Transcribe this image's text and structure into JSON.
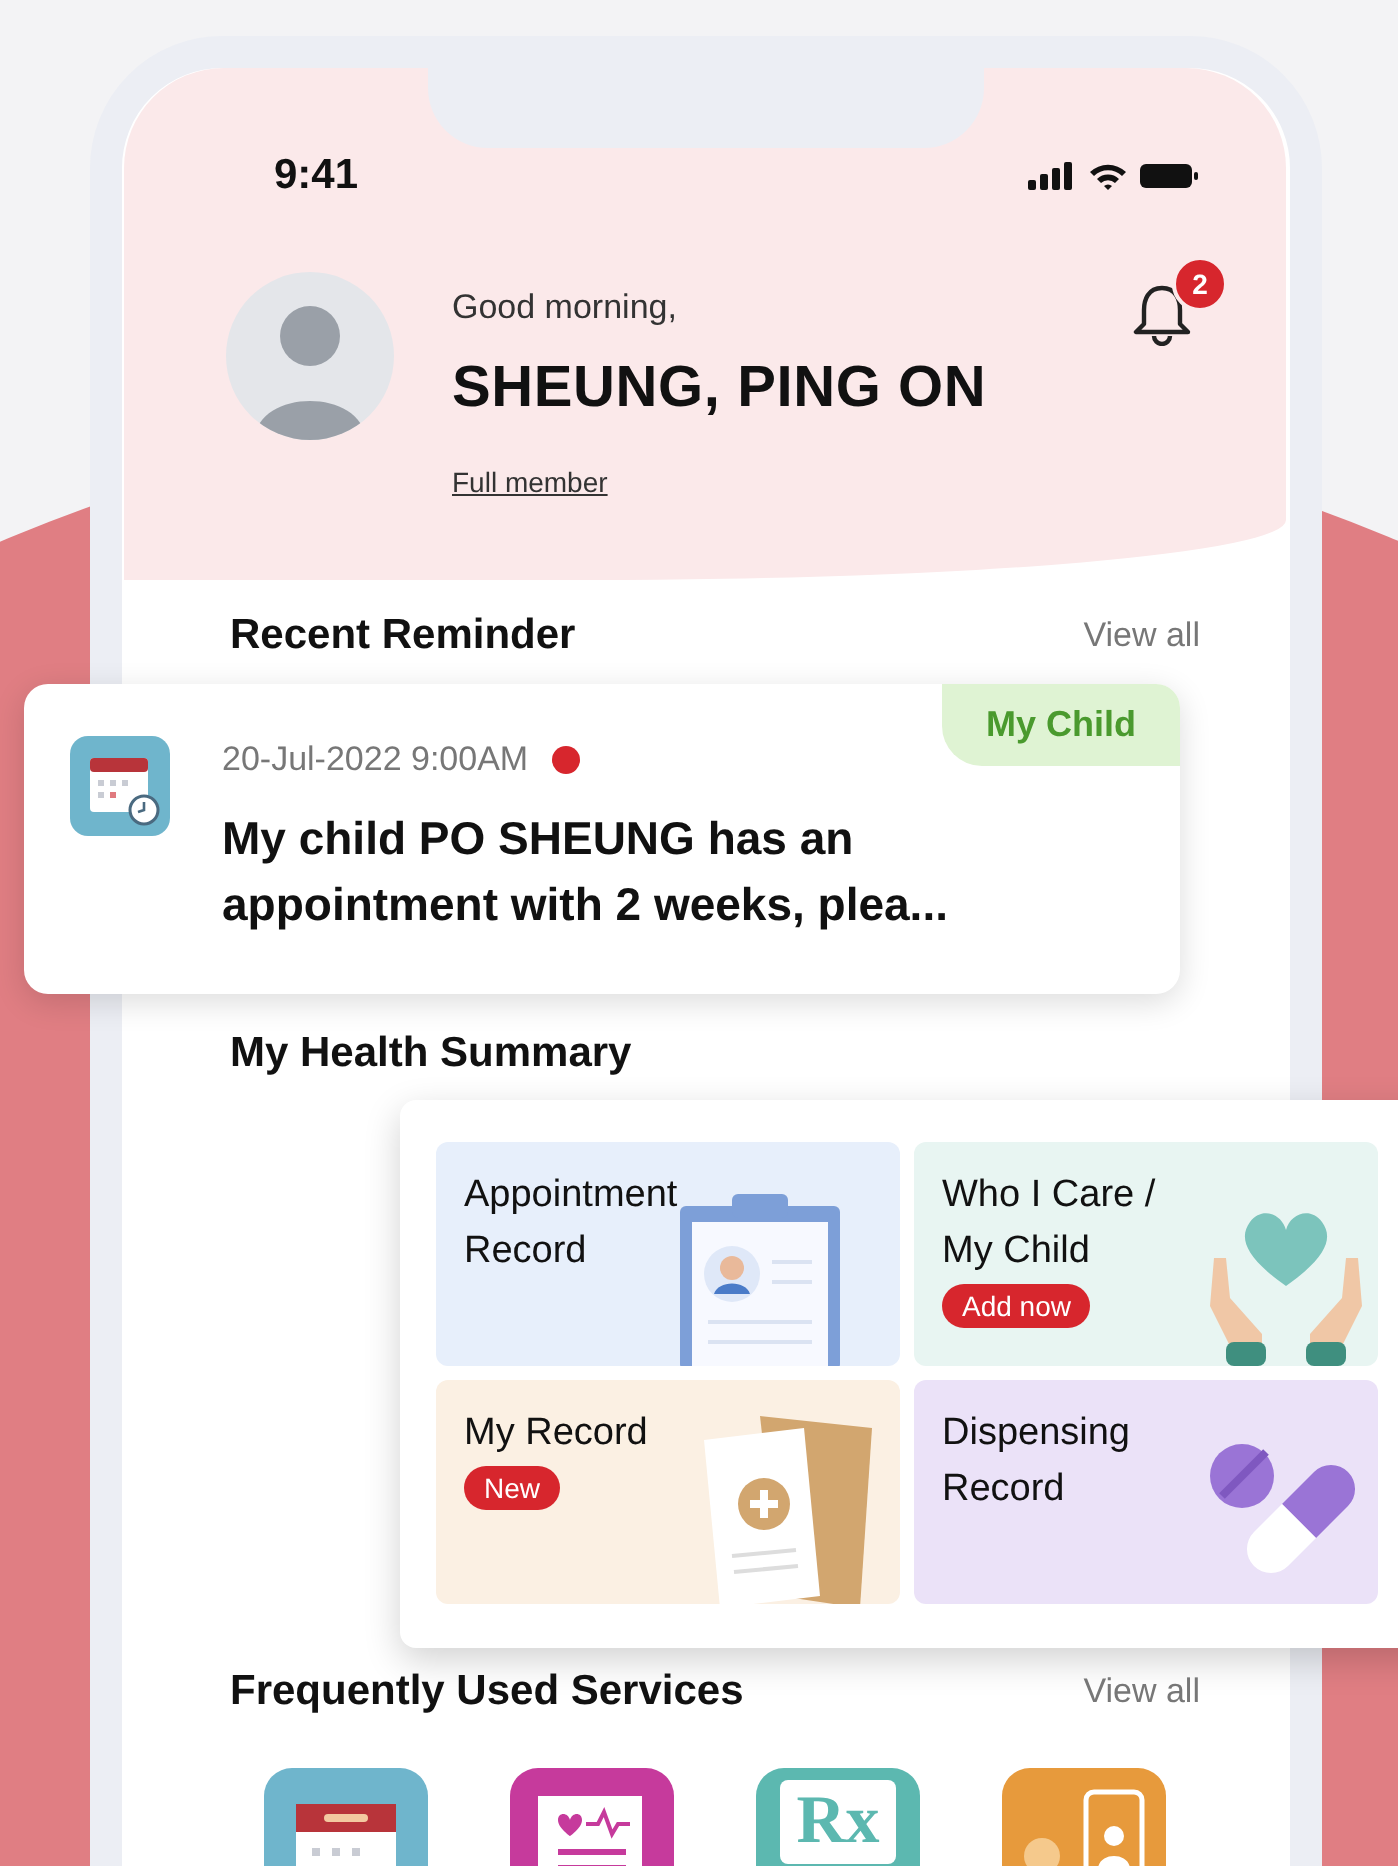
{
  "status_bar": {
    "time": "9:41"
  },
  "header": {
    "greeting": "Good morning,",
    "name": "SHEUNG, PING ON",
    "membership": "Full member",
    "notification_badge": "2"
  },
  "recent_reminder": {
    "title": "Recent Reminder",
    "view_all": "View all",
    "items": [
      {
        "datetime": "20-Jul-2022 9:00AM",
        "unread": true,
        "message": "My child PO SHEUNG has an appointment with 2 weeks, plea...",
        "tag": "My Child"
      }
    ]
  },
  "health_summary": {
    "title": "My Health Summary",
    "tiles": [
      {
        "kind": "appointment",
        "label": "Appointment Record",
        "color": "#e7effb"
      },
      {
        "kind": "care",
        "label": "Who I Care / My Child",
        "badge": "Add now",
        "color": "#e8f5f2"
      },
      {
        "kind": "record",
        "label": "My Record",
        "badge": "New",
        "color": "#fbf0e3"
      },
      {
        "kind": "dispensing",
        "label": "Dispensing Record",
        "color": "#ebe2f8"
      }
    ]
  },
  "frequently_used_services": {
    "title": "Frequently Used Services",
    "view_all": "View all",
    "services": [
      {
        "kind": "calendar"
      },
      {
        "kind": "notebook"
      },
      {
        "kind": "prescription",
        "symbol": "Rx"
      },
      {
        "kind": "telehealth"
      }
    ]
  }
}
